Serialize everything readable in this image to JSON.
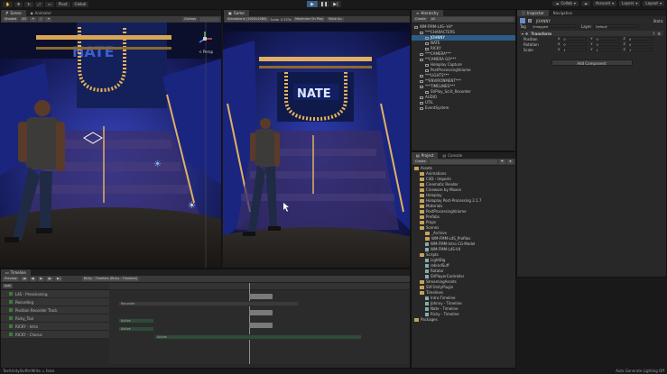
{
  "topbar": {
    "account_icon": "user-icon",
    "tools": [
      "Pivot",
      "Global"
    ],
    "collab_label": "Collab",
    "account_label": "Account",
    "layers_label": "Layers",
    "layout_label": "Layout"
  },
  "scene": {
    "tabs": [
      "Scene",
      "Animator"
    ],
    "toolbar_shaded": "Shaded",
    "toolbar_2d": "2D",
    "toolbar_gizmos": "Gizmos",
    "persp_label": "< Persp"
  },
  "game": {
    "tab": "Game",
    "display": "Standalone (1920x1080)",
    "scale_label": "Scale",
    "scale_value": "0.333x",
    "maximize": "Maximize On Play",
    "mute": "Mute Au"
  },
  "hierarchy": {
    "tab": "Hierarchy",
    "create_label": "Create",
    "search_placeholder": "All",
    "items": [
      {
        "label": "WM-FMM-L4S--V4*",
        "depth": 0
      },
      {
        "label": "***CHARACTERS",
        "depth": 1
      },
      {
        "label": "JOHNNY",
        "depth": 2,
        "selected": true
      },
      {
        "label": "NATE",
        "depth": 2
      },
      {
        "label": "RICKY",
        "depth": 2
      },
      {
        "label": "***CAMERA***",
        "depth": 1
      },
      {
        "label": "**CAMERA GO***",
        "depth": 1
      },
      {
        "label": "Holoplay Capture",
        "depth": 2
      },
      {
        "label": "PostProcessingVolume",
        "depth": 2
      },
      {
        "label": "***LIGHTS***",
        "depth": 1
      },
      {
        "label": "**ENVIRONMENT***",
        "depth": 1
      },
      {
        "label": "***TIMELINES***",
        "depth": 1
      },
      {
        "label": "SVPlay_Scrit_Recorder",
        "depth": 2
      },
      {
        "label": "AUDIO",
        "depth": 1
      },
      {
        "label": "UTIL",
        "depth": 1
      },
      {
        "label": "EventSystem",
        "depth": 1
      }
    ]
  },
  "inspector": {
    "tabs": [
      "Inspector",
      "Navigation"
    ],
    "object_name": "JOHNNY",
    "static_label": "Static",
    "tag_label": "Tag",
    "tag_value": "Untagged",
    "layer_label": "Layer",
    "layer_value": "Default",
    "component": "Transform",
    "rows": [
      {
        "label": "Position",
        "x": "0",
        "y": "0",
        "z": "0"
      },
      {
        "label": "Rotation",
        "x": "0",
        "y": "0",
        "z": "0"
      },
      {
        "label": "Scale",
        "x": "1",
        "y": "1",
        "z": "1"
      }
    ],
    "add_component": "Add Component"
  },
  "project": {
    "tabs": [
      "Project",
      "Console"
    ],
    "create_label": "Create",
    "items": [
      {
        "label": "Assets",
        "depth": 0,
        "type": "folder"
      },
      {
        "label": "Animations",
        "depth": 1,
        "type": "folder"
      },
      {
        "label": "C4D - Imports",
        "depth": 1,
        "type": "folder"
      },
      {
        "label": "Cinematic Render",
        "depth": 1,
        "type": "folder"
      },
      {
        "label": "Cineware by Maxon",
        "depth": 1,
        "type": "folder"
      },
      {
        "label": "Holoplay",
        "depth": 1,
        "type": "folder"
      },
      {
        "label": "Holoplay Post-Processing 2.1.7",
        "depth": 1,
        "type": "folder"
      },
      {
        "label": "Materials",
        "depth": 1,
        "type": "folder"
      },
      {
        "label": "PostProcessingVolume",
        "depth": 1,
        "type": "folder"
      },
      {
        "label": "Prefabs",
        "depth": 1,
        "type": "folder"
      },
      {
        "label": "Props",
        "depth": 1,
        "type": "folder"
      },
      {
        "label": "Scenes",
        "depth": 1,
        "type": "folder"
      },
      {
        "label": "_Archive",
        "depth": 2,
        "type": "folder"
      },
      {
        "label": "WM-FMM-L4S_Profiles",
        "depth": 2,
        "type": "folder"
      },
      {
        "label": "WM-FMM-Intro CG-Model",
        "depth": 2,
        "type": "file"
      },
      {
        "label": "WM-FMM-L4S-V4",
        "depth": 2,
        "type": "file"
      },
      {
        "label": "Scripts",
        "depth": 1,
        "type": "folder"
      },
      {
        "label": "LightBig",
        "depth": 2,
        "type": "file"
      },
      {
        "label": "rebindSuff",
        "depth": 2,
        "type": "file"
      },
      {
        "label": "Rotator",
        "depth": 2,
        "type": "file"
      },
      {
        "label": "SVPlayerController",
        "depth": 2,
        "type": "file"
      },
      {
        "label": "StreamingAssets",
        "depth": 1,
        "type": "folder"
      },
      {
        "label": "SVFUnityPlugin",
        "depth": 1,
        "type": "folder"
      },
      {
        "label": "Timelines",
        "depth": 1,
        "type": "folder"
      },
      {
        "label": "Intro-Timeline",
        "depth": 2,
        "type": "file"
      },
      {
        "label": "Johnny - Timeline",
        "depth": 2,
        "type": "file"
      },
      {
        "label": "Nate - Timeline",
        "depth": 2,
        "type": "file"
      },
      {
        "label": "Ricky - Timeline",
        "depth": 2,
        "type": "file"
      },
      {
        "label": "Packages",
        "depth": 0,
        "type": "folder"
      }
    ]
  },
  "timeline": {
    "tab": "Timeline",
    "preview_label": "Preview",
    "asset": "Ricky - Timeline (Ricky - Timeline)",
    "add_label": "Add",
    "tracks": [
      {
        "label": "L4S - Previsioning"
      },
      {
        "label": "Recording"
      },
      {
        "label": "Position Recorder Track"
      },
      {
        "label": "Ricky_Tsol"
      },
      {
        "label": "RICKY - Intro"
      },
      {
        "label": "RICKY - Chorus"
      }
    ],
    "clip_labels": [
      "Recorder",
      "Active",
      "Active",
      "Active"
    ]
  },
  "status": {
    "message": "TextUnity.BufferWrite = false",
    "right": "Auto Generate Lighting Off"
  }
}
